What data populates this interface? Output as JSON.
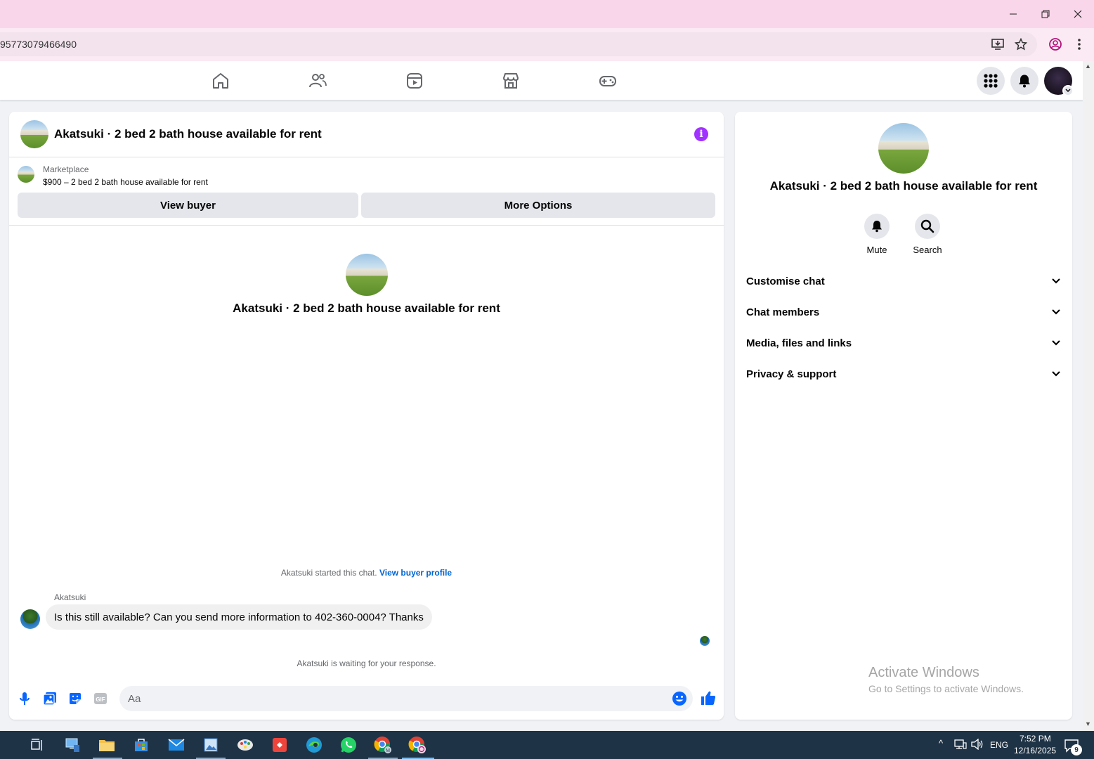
{
  "browser": {
    "url": "95773079466490"
  },
  "chat": {
    "title": "Akatsuki · 2 bed 2 bath house available for rent",
    "marketplace_label": "Marketplace",
    "listing": "$900 – 2 bed 2 bath house available for rent",
    "view_buyer": "View buyer",
    "more_options": "More Options",
    "center_title": "Akatsuki · 2 bed 2 bath house available for rent",
    "started_text": "Akatsuki started this chat.",
    "view_buyer_profile": "View buyer profile",
    "sender": "Akatsuki",
    "message": "Is this still available? Can you send more information to 402-360-0004? Thanks",
    "waiting": "Akatsuki is waiting for your response.",
    "composer_placeholder": "Aa"
  },
  "side": {
    "title": "Akatsuki · 2 bed 2 bath house available for rent",
    "mute": "Mute",
    "search": "Search",
    "sections": [
      "Customise chat",
      "Chat members",
      "Media, files and links",
      "Privacy & support"
    ]
  },
  "watermark": {
    "line1": "Activate Windows",
    "line2": "Go to Settings to activate Windows."
  },
  "taskbar": {
    "language": "ENG",
    "time": "7:52 PM",
    "date": "12/16/2025",
    "notifications": "9"
  },
  "colors": {
    "accent": "#a033ff",
    "link": "#0064d1",
    "titlebar": "#f9d6ea"
  }
}
